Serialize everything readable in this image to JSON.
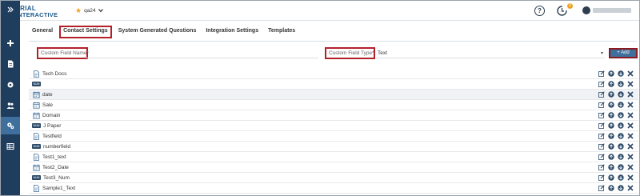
{
  "app": {
    "logo_line1": "TRIAL",
    "logo_line2": "INTERACTIVE",
    "study_name": "qa24",
    "help_label": "?",
    "notif_count": "0"
  },
  "sidebar": {
    "items": [
      {
        "icon": "expand-icon"
      },
      {
        "icon": "plus-icon"
      },
      {
        "icon": "document-icon"
      },
      {
        "icon": "gear-icon"
      },
      {
        "icon": "users-icon"
      },
      {
        "icon": "cogs-icon",
        "active": true
      },
      {
        "icon": "table-icon"
      }
    ]
  },
  "tabs": [
    {
      "label": "General"
    },
    {
      "label": "Contact Settings",
      "active": true
    },
    {
      "label": "System Generated Questions"
    },
    {
      "label": "Integration Settings"
    },
    {
      "label": "Templates"
    }
  ],
  "form": {
    "name_placeholder": "Custom Field Name*",
    "type_label": "Custom Field Type*",
    "type_value": "Text",
    "add_label": "+ Add"
  },
  "rows": [
    {
      "type": "doc",
      "label": "Tech Docs",
      "shaded": false
    },
    {
      "type": "badge",
      "label": "",
      "shaded": false
    },
    {
      "type": "cal",
      "label": "date",
      "shaded": true
    },
    {
      "type": "cal",
      "label": "Sale",
      "shaded": false
    },
    {
      "type": "cal",
      "label": "Domain",
      "shaded": false
    },
    {
      "type": "badge",
      "label": "J Paper",
      "shaded": false
    },
    {
      "type": "doc",
      "label": "Testfield",
      "shaded": false
    },
    {
      "type": "badge",
      "label": "numberfield",
      "shaded": false
    },
    {
      "type": "doc",
      "label": "Test1_text",
      "shaded": false
    },
    {
      "type": "cal",
      "label": "Test2_Date",
      "shaded": false
    },
    {
      "type": "badge",
      "label": "Test3_Num",
      "shaded": false
    },
    {
      "type": "doc",
      "label": "Sample1_Text",
      "shaded": false
    }
  ],
  "badge_text": "NUM",
  "colors": {
    "sidebar": "#1f3d5c",
    "sidebar_active": "#3f6f9c",
    "highlight": "#b3202a",
    "add_button": "#3f6f9c"
  }
}
